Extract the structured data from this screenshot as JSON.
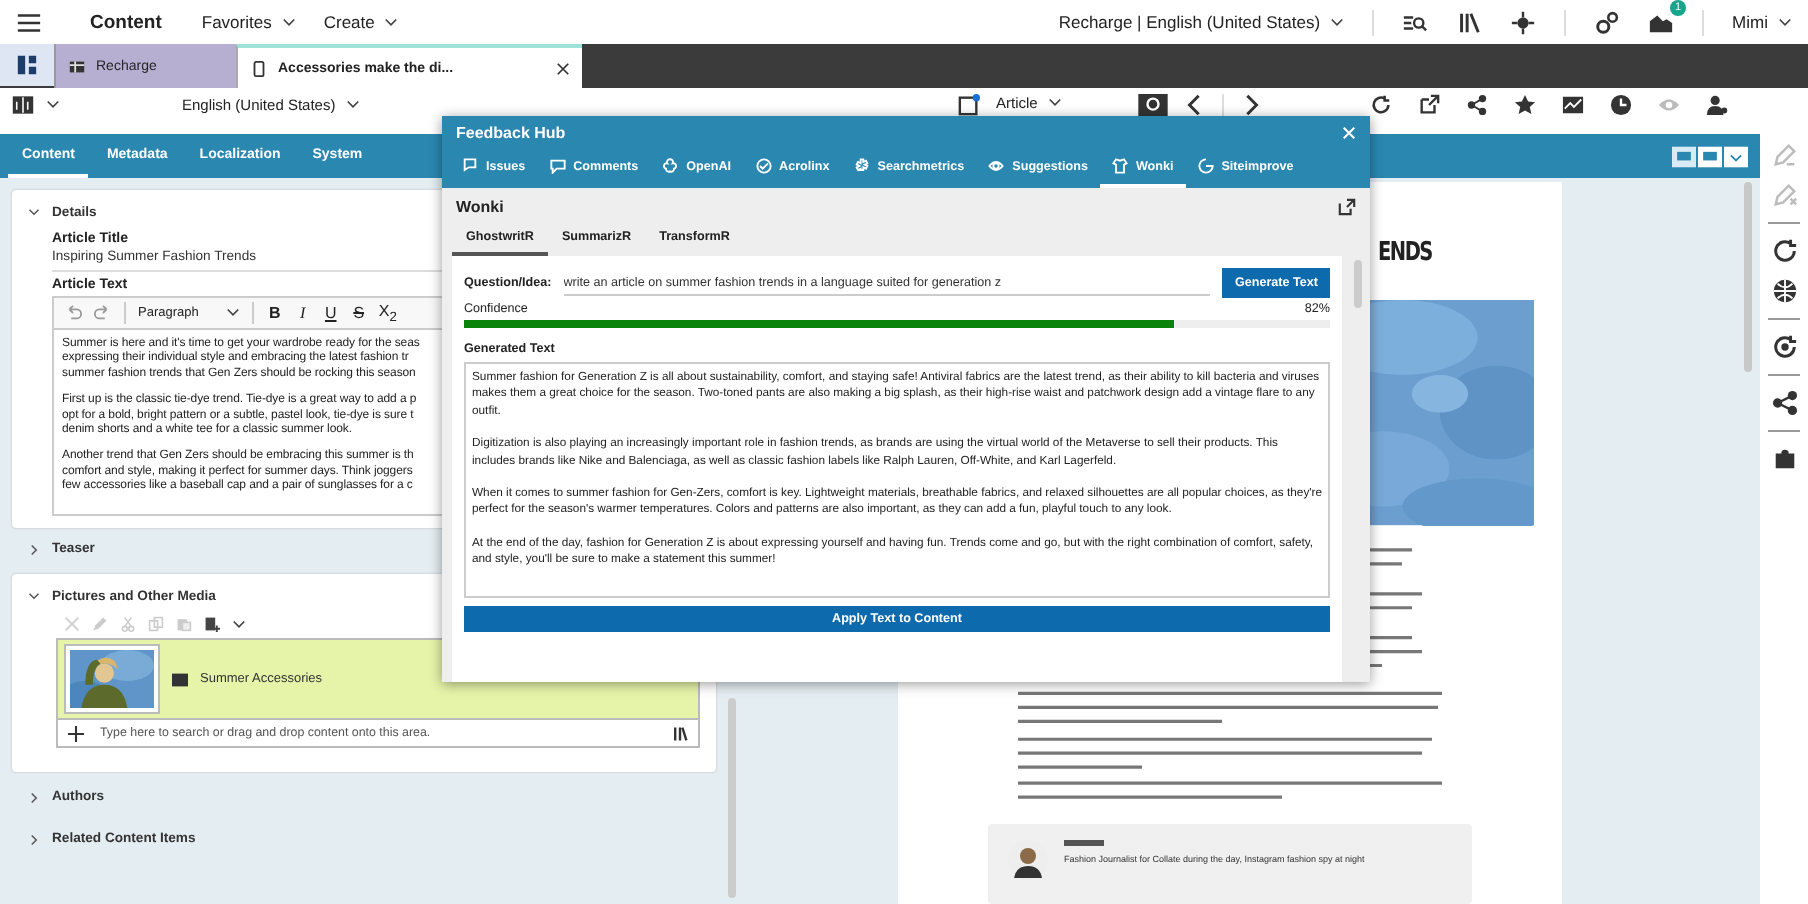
{
  "top_bar": {
    "title": "Content",
    "menus": [
      {
        "label": "Favorites"
      },
      {
        "label": "Create"
      }
    ],
    "site_selector": "Recharge | English (United States)",
    "notification_count": "1",
    "user": "Mimi"
  },
  "tabs": [
    {
      "label": "Recharge",
      "kind": "site",
      "selected": false
    },
    {
      "label": "Accessories make the di...",
      "kind": "article",
      "selected": true
    }
  ],
  "toolbar": {
    "locale": "English (United States)",
    "doc_type": "Article"
  },
  "form_tabs": [
    {
      "label": "Content",
      "selected": true
    },
    {
      "label": "Metadata",
      "selected": false
    },
    {
      "label": "Localization",
      "selected": false
    },
    {
      "label": "System",
      "selected": false
    }
  ],
  "details": {
    "heading": "Details",
    "expanded": true,
    "title_label": "Article Title",
    "title_value": "Inspiring Summer Fashion Trends",
    "text_label": "Article Text",
    "format": "Paragraph",
    "format_buttons": [
      "B",
      "I",
      "U",
      "S",
      "X$_{2}$"
    ],
    "paragraphs": [
      [
        "Summer is here and it's time to get your wardrobe ready for the seas",
        "expressing their individual style and embracing the latest fashion tr",
        "summer fashion trends that Gen Zers should be rocking this season"
      ],
      [
        "First up is the classic tie-dye trend. Tie-dye is a great way to add a p",
        "opt for a bold, bright pattern or a subtle, pastel look, tie-dye is sure t",
        "denim shorts and a white tee for a classic summer look."
      ],
      [
        "Another trend that Gen Zers should be embracing this summer is th",
        "comfort and style, making it perfect for summer days. Think joggers",
        "few accessories like a baseball cap and a pair of sunglasses for a c"
      ]
    ]
  },
  "sections": [
    {
      "heading": "Teaser",
      "kind": "plain",
      "expanded": false
    },
    {
      "heading": "Pictures and Other Media",
      "kind": "media",
      "expanded": true,
      "items": [
        {
          "kind": "picture",
          "label": "Summer Accessories"
        }
      ],
      "placeholder": "Type here to search or drag and drop content onto this area."
    },
    {
      "heading": "Authors",
      "kind": "plain",
      "expanded": false
    },
    {
      "heading": "Related Content Items",
      "kind": "plain",
      "expanded": false
    }
  ],
  "preview": {
    "heading": "ENDS",
    "author_caption": "Fashion Journalist for Collate during the day, Instagram fashion spy at night"
  },
  "dialog": {
    "title": "Feedback Hub",
    "tabs": [
      {
        "label": "Issues",
        "selected": false
      },
      {
        "label": "Comments",
        "selected": false
      },
      {
        "label": "OpenAI",
        "selected": false
      },
      {
        "label": "Acrolinx",
        "selected": false
      },
      {
        "label": "Searchmetrics",
        "selected": false
      },
      {
        "label": "Suggestions",
        "selected": false
      },
      {
        "label": "Wonki",
        "selected": true
      },
      {
        "label": "Siteimprove",
        "selected": false
      }
    ],
    "panel_title": "Wonki",
    "sub_tabs": [
      {
        "label": "GhostwritR",
        "selected": true
      },
      {
        "label": "SummarizR",
        "selected": false
      },
      {
        "label": "TransformR",
        "selected": false
      }
    ],
    "question_label": "Question/Idea:",
    "question": "write an article on summer fashion trends in a language suited for generation z",
    "generate_button": "Generate Text",
    "confidence_label": "Confidence",
    "confidence_reading": "82%",
    "confidence": {
      "level": 0.82
    },
    "generated_label": "Generated Text",
    "generated": [
      "Summer fashion for Generation Z is all about sustainability, comfort, and staying safe! Antiviral fabrics are the latest trend, as their ability to kill bacteria and viruses makes them a great choice for the season. Two-toned pants are also making a big splash, as their high-rise waist and patchwork design add a vintage flare to any outfit.",
      "Digitization is also playing an increasingly important role in fashion trends, as brands are using the virtual world of the Metaverse to sell their products. This includes brands like Nike and Balenciaga, as well as classic fashion labels like Ralph Lauren, Off-White, and Karl Lagerfeld.",
      "When it comes to summer fashion for Gen-Zers, comfort is key. Lightweight materials, breathable fabrics, and relaxed silhouettes are all popular choices, as they're perfect for the season's warmer temperatures. Colors and patterns are also important, as they can add a fun, playful touch to any look.",
      "At the end of the day, fashion for Generation Z is about expressing yourself and having fun. Trends come and go, but with the right combination of comfort, safety, and style, you'll be sure to make a statement this summer!"
    ],
    "apply_button": "Apply Text to Content"
  }
}
